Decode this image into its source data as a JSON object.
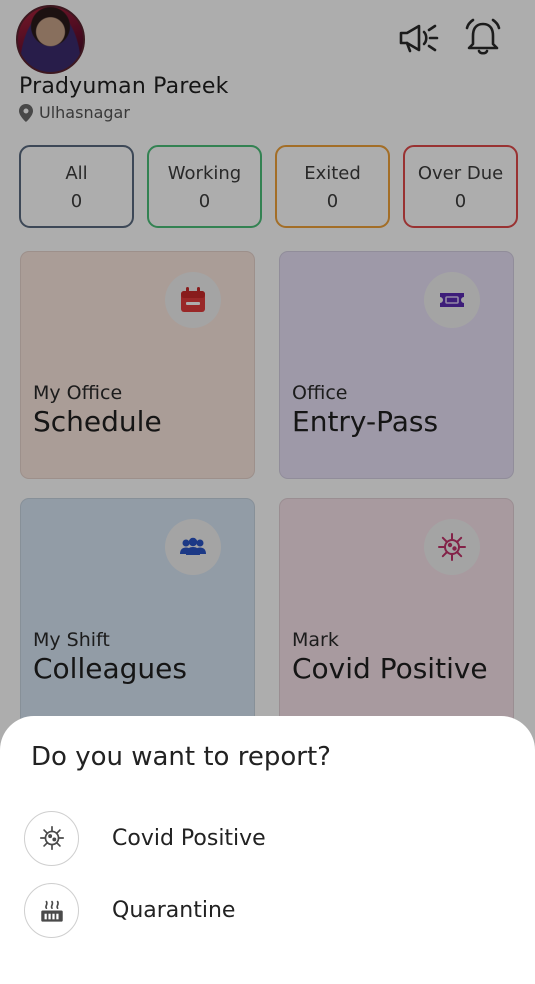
{
  "profile": {
    "name": "Pradyuman Pareek",
    "location": "Ulhasnagar"
  },
  "header_icons": [
    "megaphone-icon",
    "alarm-bell-icon"
  ],
  "status": [
    {
      "label": "All",
      "count": "0",
      "color": "#5a6b80"
    },
    {
      "label": "Working",
      "count": "0",
      "color": "#4cc07a"
    },
    {
      "label": "Exited",
      "count": "0",
      "color": "#f0a23a"
    },
    {
      "label": "Over Due",
      "count": "0",
      "color": "#e24b4b"
    }
  ],
  "cards": [
    {
      "small": "My Office",
      "big": "Schedule",
      "icon": "calendar-icon",
      "bg": "#fbe7df",
      "icon_color": "#e23b3b"
    },
    {
      "small": "Office",
      "big": "Entry-Pass",
      "icon": "ticket-icon",
      "bg": "#e9e2f8",
      "icon_color": "#5a2bb3"
    },
    {
      "small": "My Shift",
      "big": "Colleagues",
      "icon": "group-icon",
      "bg": "#d8e6f5",
      "icon_color": "#2a54c6"
    },
    {
      "small": "Mark",
      "big": "Covid Positive",
      "icon": "virus-icon",
      "bg": "#f8e3ea",
      "icon_color": "#c2336a"
    }
  ],
  "sheet": {
    "title": "Do you want to report?",
    "options": [
      {
        "label": "Covid Positive",
        "icon": "virus-icon"
      },
      {
        "label": "Quarantine",
        "icon": "quarantine-icon"
      }
    ]
  }
}
